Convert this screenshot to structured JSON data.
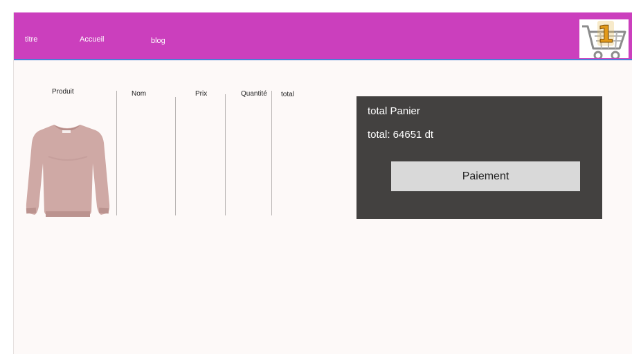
{
  "nav": {
    "titre": "titre",
    "accueil": "Accueil",
    "blog": "blog"
  },
  "cart": {
    "count": "1"
  },
  "table": {
    "headers": [
      "Produit",
      "Nom",
      "Prix",
      "Quantité",
      "total"
    ]
  },
  "summary": {
    "title": "total Panier",
    "total": "total: 64651 dt",
    "pay_label": "Paiement"
  },
  "colors": {
    "navbar": "#cb3fbd",
    "panel": "#434140",
    "button": "#d9d9d9",
    "page_bg": "#fdf9f8"
  }
}
